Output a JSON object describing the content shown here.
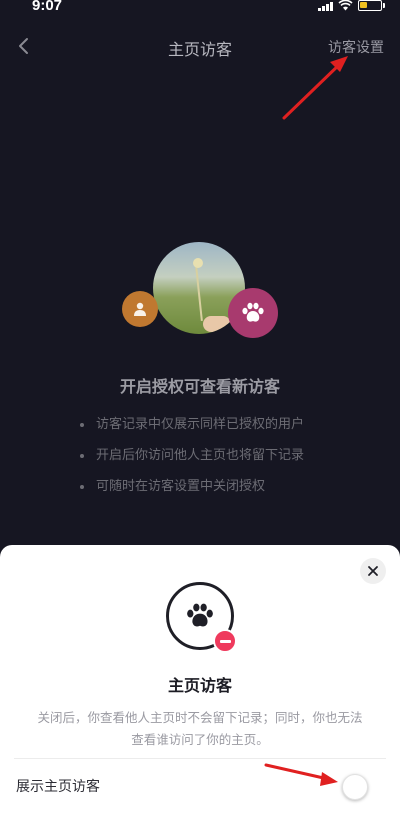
{
  "status_bar": {
    "time": "9:07"
  },
  "header": {
    "title": "主页访客",
    "settings_label": "访客设置"
  },
  "hero": {
    "heading": "开启授权可查看新访客",
    "bullets": [
      "访客记录中仅展示同样已授权的用户",
      "开启后你访问他人主页也将留下记录",
      "可随时在访客设置中关闭授权"
    ]
  },
  "sheet": {
    "title": "主页访客",
    "description_line1": "关闭后，你查看他人主页时不会留下记录；同时，你也无法",
    "description_line2": "查看谁访问了你的主页。",
    "toggle_label": "展示主页访客",
    "toggle_on": false
  },
  "colors": {
    "background": "#161622",
    "accent_pink": "#ef3a5d",
    "annotation_red": "#e02020"
  }
}
